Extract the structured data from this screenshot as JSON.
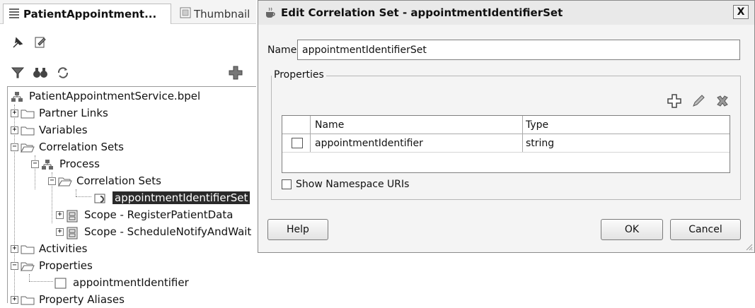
{
  "left_panel": {
    "tabs": [
      {
        "label": "PatientAppointment...",
        "icon": "list-icon",
        "active": true
      },
      {
        "label": "Thumbnail",
        "icon": "thumbnail-icon",
        "active": false
      }
    ],
    "toolbar_icons": [
      "pin-icon",
      "edit-icon"
    ],
    "filter_icons": [
      "filter-icon",
      "binoculars-icon",
      "refresh-icon",
      "add-icon"
    ],
    "tree": [
      {
        "label": "PatientAppointmentService.bpel",
        "icon": "process-icon"
      },
      {
        "label": "Partner Links",
        "icon": "folder-icon"
      },
      {
        "label": "Variables",
        "icon": "folder-icon"
      },
      {
        "label": "Correlation Sets",
        "icon": "open-folder-icon"
      },
      {
        "label": "Process",
        "icon": "process-icon"
      },
      {
        "label": "Correlation Sets",
        "icon": "open-folder-icon"
      },
      {
        "label": "appointmentIdentifierSet",
        "icon": "correlation-set-icon",
        "selected": true
      },
      {
        "label": "Scope - RegisterPatientData",
        "icon": "scope-icon"
      },
      {
        "label": "Scope - ScheduleNotifyAndWait",
        "icon": "scope-icon"
      },
      {
        "label": "Activities",
        "icon": "folder-icon"
      },
      {
        "label": "Properties",
        "icon": "open-folder-icon"
      },
      {
        "label": "appointmentIdentifier",
        "icon": "property-icon"
      },
      {
        "label": "Property Aliases",
        "icon": "folder-icon"
      }
    ]
  },
  "dialog": {
    "title": "Edit Correlation Set - appointmentIdentifierSet",
    "close_label": "X",
    "name_label": "Name:",
    "name_value": "appointmentIdentifierSet",
    "properties_legend": "Properties",
    "tool_icons": [
      "add-icon",
      "edit-pencil-icon",
      "delete-icon"
    ],
    "table": {
      "columns": [
        "Name",
        "Type"
      ],
      "rows": [
        {
          "name": "appointmentIdentifier",
          "type": "string"
        }
      ]
    },
    "show_namespace_label": "Show Namespace URIs",
    "show_namespace_checked": false,
    "help_button": "Help",
    "ok_button": "OK",
    "cancel_button": "Cancel"
  },
  "colors": {
    "selection": "#2a2a2a",
    "dialog_bg": "#f4f4f4",
    "border": "#7f7f7f"
  }
}
